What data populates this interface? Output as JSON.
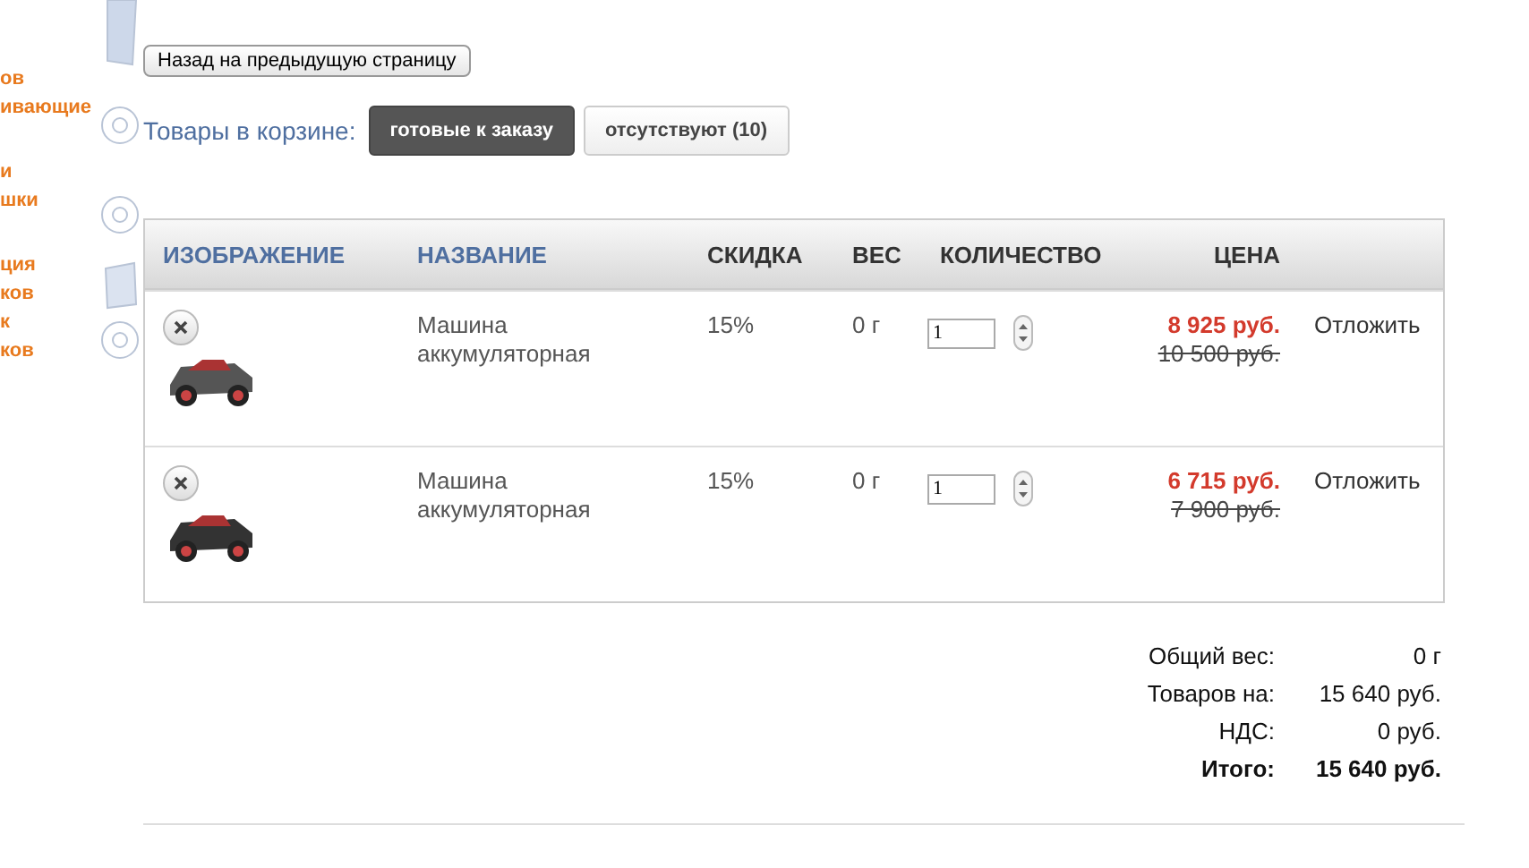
{
  "sidebar": {
    "items": [
      "ов",
      "ивающие",
      "и",
      "шки",
      "ция",
      "ков",
      "к",
      "ков"
    ]
  },
  "back_button": "Назад на предыдущую страницу",
  "filter": {
    "label": "Товары в корзине:",
    "tabs": [
      {
        "label": "готовые к заказу",
        "selected": true
      },
      {
        "label": "отсутствуют (10)",
        "selected": false
      }
    ]
  },
  "table": {
    "columns": [
      {
        "label": "ИЗОБРАЖЕНИЕ",
        "kind": "link"
      },
      {
        "label": "НАЗВАНИЕ",
        "kind": "link"
      },
      {
        "label": "СКИДКА",
        "kind": "plain"
      },
      {
        "label": "ВЕС",
        "kind": "plain"
      },
      {
        "label": "КОЛИЧЕСТВО",
        "kind": "plain"
      },
      {
        "label": "ЦЕНА",
        "kind": "plain"
      }
    ],
    "rows": [
      {
        "name": "Машина аккумуляторная",
        "discount": "15%",
        "weight": "0 г",
        "quantity": "1",
        "price": "8 925 руб.",
        "old_price": "10 500 руб.",
        "action": "Отложить"
      },
      {
        "name": "Машина аккумуляторная",
        "discount": "15%",
        "weight": "0 г",
        "quantity": "1",
        "price": "6 715 руб.",
        "old_price": "7 900 руб.",
        "action": "Отложить"
      }
    ]
  },
  "summary": [
    {
      "label": "Общий вес:",
      "value": "0 г",
      "bold": false
    },
    {
      "label": "Товаров на:",
      "value": "15 640 руб.",
      "bold": false
    },
    {
      "label": "НДС:",
      "value": "0 руб.",
      "bold": false
    },
    {
      "label": "Итого:",
      "value": "15 640 руб.",
      "bold": true
    }
  ]
}
